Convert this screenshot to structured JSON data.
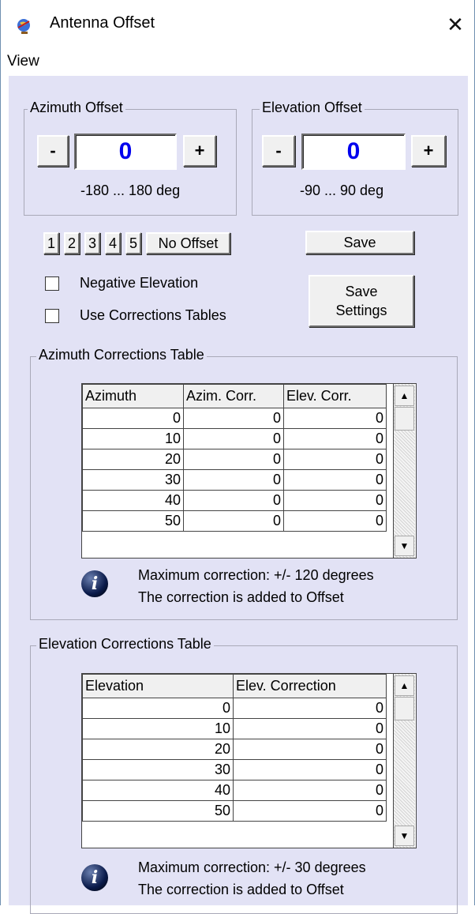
{
  "window": {
    "title": "Antenna Offset",
    "close_glyph": "✕",
    "app_icon": "antenna-globe-icon"
  },
  "menu": {
    "items": [
      "View"
    ]
  },
  "azimuth_offset": {
    "label": "Azimuth Offset",
    "minus": "-",
    "plus": "+",
    "value": "0",
    "range": "-180 ... 180 deg"
  },
  "elevation_offset": {
    "label": "Elevation Offset",
    "minus": "-",
    "plus": "+",
    "value": "0",
    "range": "-90 ... 90 deg"
  },
  "presets": {
    "buttons": [
      "1",
      "2",
      "3",
      "4",
      "5"
    ],
    "no_offset": "No Offset",
    "save": "Save"
  },
  "options": {
    "negative_elevation": {
      "label": "Negative Elevation",
      "checked": false
    },
    "use_corrections_tables": {
      "label": "Use Corrections Tables",
      "checked": false
    },
    "save_settings_line1": "Save",
    "save_settings_line2": "Settings"
  },
  "azimuth_table": {
    "group_label": "Azimuth Corrections Table",
    "columns": [
      "Azimuth",
      "Azim. Corr.",
      "Elev. Corr."
    ],
    "rows": [
      [
        "0",
        "0",
        "0"
      ],
      [
        "10",
        "0",
        "0"
      ],
      [
        "20",
        "0",
        "0"
      ],
      [
        "30",
        "0",
        "0"
      ],
      [
        "40",
        "0",
        "0"
      ],
      [
        "50",
        "0",
        "0"
      ]
    ],
    "info_line1": "Maximum correction: +/- 120 degrees",
    "info_line2": "The correction is added to Offset"
  },
  "elevation_table": {
    "group_label": "Elevation Corrections Table",
    "columns": [
      "Elevation",
      "Elev. Correction"
    ],
    "rows": [
      [
        "0",
        "0"
      ],
      [
        "10",
        "0"
      ],
      [
        "20",
        "0"
      ],
      [
        "30",
        "0"
      ],
      [
        "40",
        "0"
      ],
      [
        "50",
        "0"
      ]
    ],
    "info_line1": "Maximum correction: +/- 30 degrees",
    "info_line2": "The correction is added to Offset"
  },
  "scroll": {
    "up_glyph": "▲",
    "down_glyph": "▼"
  },
  "colors": {
    "client_bg": "#e2e2f5",
    "value_text": "#0000ee"
  }
}
